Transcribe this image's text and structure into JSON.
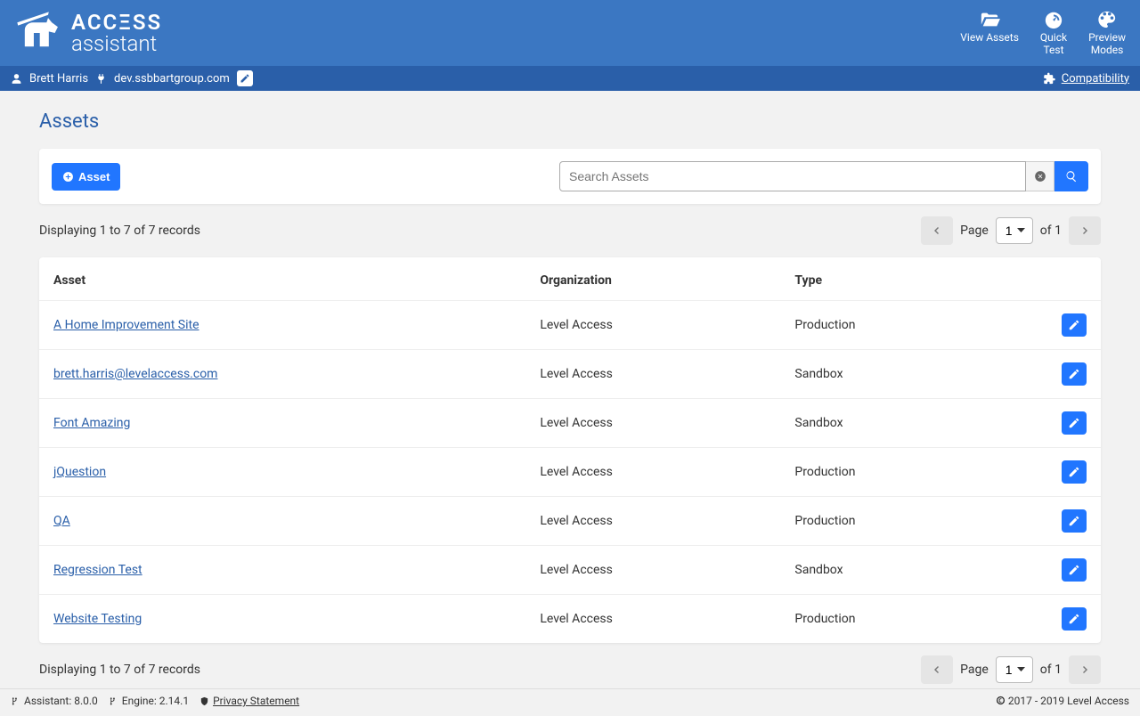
{
  "brand": {
    "line1": "ACCΞSS",
    "line2": "assistant"
  },
  "header_nav": {
    "view_assets": "View Assets",
    "quick_test": "Quick Test",
    "preview_modes": "Preview Modes"
  },
  "subbar": {
    "user": "Brett Harris",
    "domain": "dev.ssbbartgroup.com",
    "compatibility": "Compatibility"
  },
  "page_title": "Assets",
  "toolbar": {
    "add_label": "Asset",
    "search_placeholder": "Search Assets"
  },
  "pagination": {
    "summary": "Displaying 1 to 7 of 7 records",
    "page_label": "Page",
    "of_label": "of 1",
    "page_value": "1"
  },
  "table": {
    "headers": {
      "asset": "Asset",
      "organization": "Organization",
      "type": "Type"
    },
    "rows": [
      {
        "name": "A Home Improvement Site",
        "org": "Level Access",
        "type": "Production"
      },
      {
        "name": "brett.harris@levelaccess.com",
        "org": "Level Access",
        "type": "Sandbox"
      },
      {
        "name": "Font Amazing",
        "org": "Level Access",
        "type": "Sandbox"
      },
      {
        "name": "jQuestion",
        "org": "Level Access",
        "type": "Production"
      },
      {
        "name": "QA",
        "org": "Level Access",
        "type": "Production"
      },
      {
        "name": "Regression Test",
        "org": "Level Access",
        "type": "Sandbox"
      },
      {
        "name": "Website Testing",
        "org": "Level Access",
        "type": "Production"
      }
    ]
  },
  "footer": {
    "assistant": "Assistant: 8.0.0",
    "engine": "Engine: 2.14.1",
    "privacy": "Privacy Statement",
    "copyright": "2017 - 2019 Level Access"
  }
}
